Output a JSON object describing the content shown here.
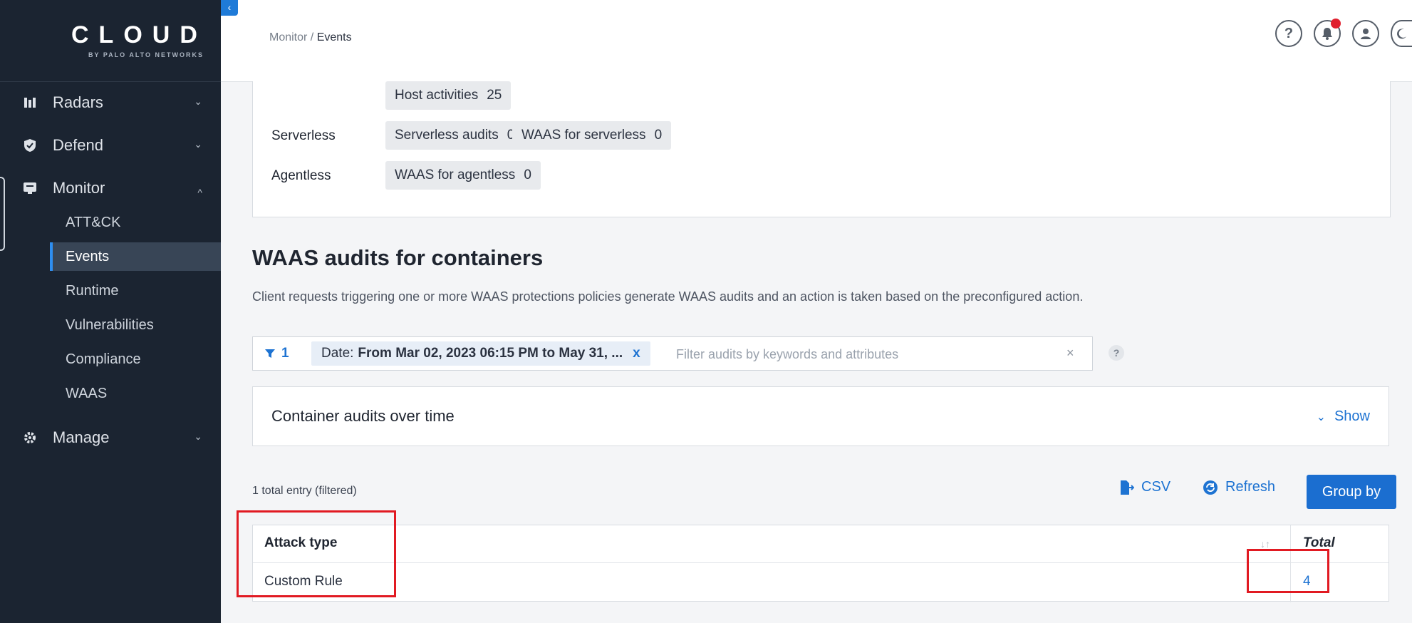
{
  "sidebar": {
    "logo_text": "CLOUD",
    "logo_sub": "BY PALO ALTO NETWORKS",
    "collapse_glyph": "‹",
    "items": [
      {
        "label": "Radars",
        "icon": "radars-icon",
        "expanded": false
      },
      {
        "label": "Defend",
        "icon": "shield-icon",
        "expanded": false
      },
      {
        "label": "Monitor",
        "icon": "monitor-icon",
        "expanded": true
      },
      {
        "label": "Manage",
        "icon": "gear-icon",
        "expanded": false
      }
    ],
    "monitor_sub": [
      {
        "label": "ATT&CK"
      },
      {
        "label": "Events",
        "active": true
      },
      {
        "label": "Runtime"
      },
      {
        "label": "Vulnerabilities"
      },
      {
        "label": "Compliance"
      },
      {
        "label": "WAAS"
      }
    ]
  },
  "header": {
    "breadcrumb_parent": "Monitor",
    "breadcrumb_sep": " / ",
    "breadcrumb_current": "Events",
    "icons": [
      "help-icon",
      "notification-icon",
      "user-icon",
      "theme-icon"
    ],
    "help_glyph": "?"
  },
  "summary_panel": {
    "host_activities": {
      "label": "Host activities",
      "count": "25"
    },
    "serverless": {
      "label": "Serverless",
      "chips": [
        {
          "label": "Serverless audits",
          "count": "0"
        },
        {
          "label": "WAAS for serverless",
          "count": "0"
        }
      ]
    },
    "agentless": {
      "label": "Agentless",
      "chips": [
        {
          "label": "WAAS for agentless",
          "count": "0"
        }
      ]
    }
  },
  "section": {
    "title": "WAAS audits for containers",
    "description": "Client requests triggering one or more WAAS protections policies generate WAAS audits and an action is taken based on the preconfigured action."
  },
  "filter": {
    "count": "1",
    "chip_prefix": "Date:",
    "chip_value": "From Mar 02, 2023 06:15 PM to May 31, ...",
    "chip_remove": "x",
    "placeholder": "Filter audits by keywords and attributes",
    "clear": "×",
    "help": "?"
  },
  "chart_panel": {
    "title": "Container audits over time",
    "toggle_label": "Show",
    "toggle_glyph": "⌄"
  },
  "table_toolbar": {
    "total_entries": "1 total entry (filtered)",
    "csv_label": "CSV",
    "refresh_label": "Refresh",
    "group_by_label": "Group by"
  },
  "table": {
    "columns": [
      "Attack type",
      "Total"
    ],
    "sort_glyph": "↓↑",
    "rows": [
      {
        "attack_type": "Custom Rule",
        "total": "4"
      }
    ]
  },
  "colors": {
    "sidebar_bg": "#1b2431",
    "accent": "#1e73d2",
    "highlight": "#e11a22",
    "notification_dot": "#e0202e"
  }
}
